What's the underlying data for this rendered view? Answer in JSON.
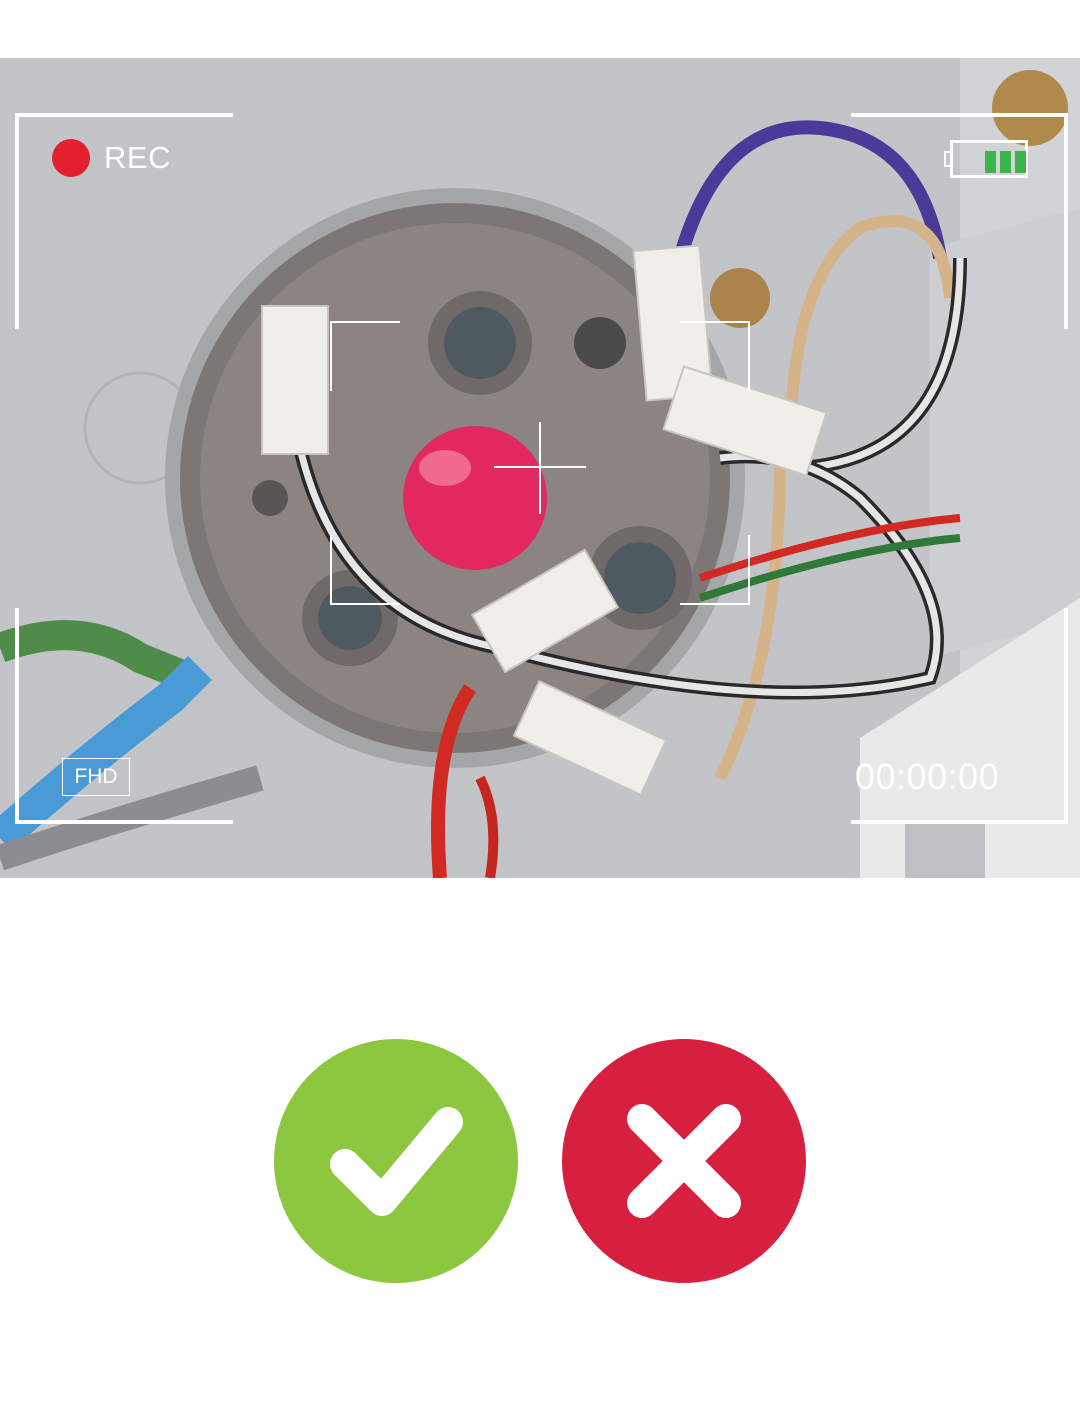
{
  "camera": {
    "rec_label": "REC",
    "battery_level": 0.75,
    "quality_label": "FHD",
    "timer": "00:00:00"
  },
  "actions": {
    "accept_icon": "checkmark-icon",
    "reject_icon": "cross-icon"
  },
  "colors": {
    "rec_dot": "#e3202f",
    "battery_cells": "#3ab54a",
    "accept": "#8dc63f",
    "reject": "#d71f3f",
    "hud": "#ffffff"
  }
}
